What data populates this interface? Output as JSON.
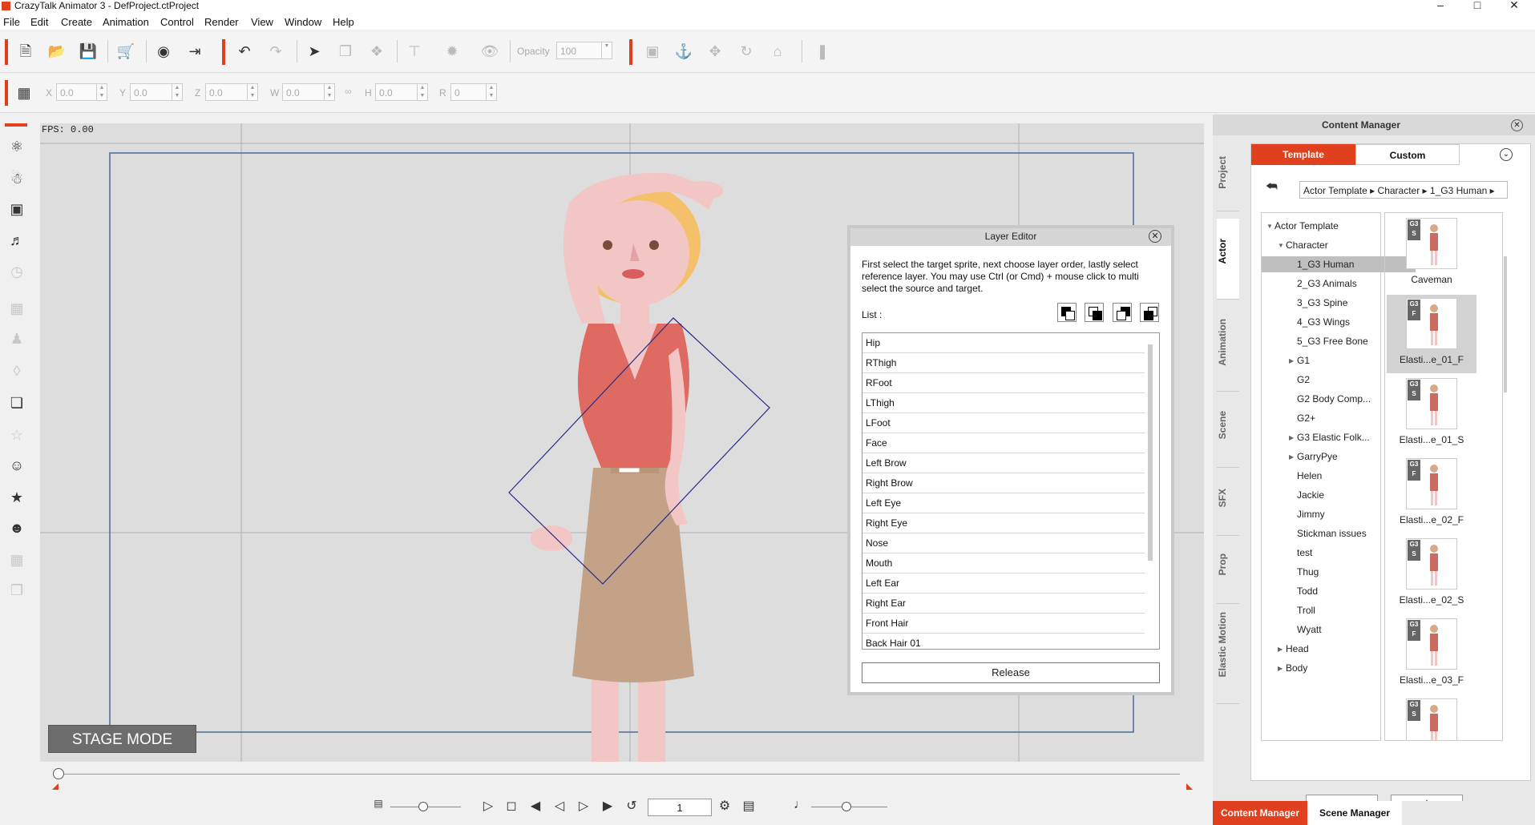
{
  "window": {
    "title": "CrazyTalk Animator 3  - DefProject.ctProject"
  },
  "menu": [
    "File",
    "Edit",
    "Create",
    "Animation",
    "Control",
    "Render",
    "View",
    "Window",
    "Help"
  ],
  "toolbar": {
    "opacity_label": "Opacity",
    "opacity_value": "100"
  },
  "transform": {
    "x_label": "X",
    "x_value": "0.0",
    "y_label": "Y",
    "y_value": "0.0",
    "z_label": "Z",
    "z_value": "0.0",
    "w_label": "W",
    "w_value": "0.0",
    "h_label": "H",
    "h_value": "0.0",
    "r_label": "R",
    "r_value": "0"
  },
  "stage": {
    "fps": "FPS: 0.00",
    "mode_label": "STAGE MODE"
  },
  "timeline": {
    "frame": "1"
  },
  "layer_editor": {
    "title": "Layer Editor",
    "description": "First select the target sprite, next choose layer order, lastly select reference layer. You may use Ctrl (or Cmd) + mouse click to multi select the source and target.",
    "list_label": "List :",
    "items": [
      "Hip",
      "RThigh",
      "RFoot",
      "LThigh",
      "LFoot",
      "Face",
      "Left Brow",
      "Right Brow",
      "Left Eye",
      "Right Eye",
      "Nose",
      "Mouth",
      "Left Ear",
      "Right Ear",
      "Front Hair",
      "Back Hair 01"
    ],
    "release_label": "Release"
  },
  "content_manager": {
    "title": "Content Manager",
    "side_tabs": [
      "Project",
      "Actor",
      "Animation",
      "Scene",
      "SFX",
      "Prop",
      "Elastic Motion"
    ],
    "active_side_tab": "Actor",
    "tabs": {
      "template": "Template",
      "custom": "Custom"
    },
    "breadcrumb": [
      "Actor Template",
      "Character",
      "1_G3 Human"
    ],
    "tree": [
      {
        "label": "Actor Template",
        "depth": 0,
        "arrow": "down"
      },
      {
        "label": "Character",
        "depth": 1,
        "arrow": "down"
      },
      {
        "label": "1_G3 Human",
        "depth": 2,
        "arrow": "",
        "selected": true
      },
      {
        "label": "2_G3 Animals",
        "depth": 2,
        "arrow": ""
      },
      {
        "label": "3_G3 Spine",
        "depth": 2,
        "arrow": ""
      },
      {
        "label": "4_G3 Wings",
        "depth": 2,
        "arrow": ""
      },
      {
        "label": "5_G3 Free Bone",
        "depth": 2,
        "arrow": ""
      },
      {
        "label": "G1",
        "depth": 2,
        "arrow": "right"
      },
      {
        "label": "G2",
        "depth": 2,
        "arrow": ""
      },
      {
        "label": "G2 Body Comp...",
        "depth": 2,
        "arrow": ""
      },
      {
        "label": "G2+",
        "depth": 2,
        "arrow": ""
      },
      {
        "label": "G3 Elastic Folk...",
        "depth": 2,
        "arrow": "right"
      },
      {
        "label": "GarryPye",
        "depth": 2,
        "arrow": "right"
      },
      {
        "label": "Helen",
        "depth": 2,
        "arrow": ""
      },
      {
        "label": "Jackie",
        "depth": 2,
        "arrow": ""
      },
      {
        "label": "Jimmy",
        "depth": 2,
        "arrow": ""
      },
      {
        "label": "Stickman issues",
        "depth": 2,
        "arrow": ""
      },
      {
        "label": "test",
        "depth": 2,
        "arrow": ""
      },
      {
        "label": "Thug",
        "depth": 2,
        "arrow": ""
      },
      {
        "label": "Todd",
        "depth": 2,
        "arrow": ""
      },
      {
        "label": "Troll",
        "depth": 2,
        "arrow": ""
      },
      {
        "label": "Wyatt",
        "depth": 2,
        "arrow": ""
      },
      {
        "label": "Head",
        "depth": 1,
        "arrow": "right"
      },
      {
        "label": "Body",
        "depth": 1,
        "arrow": "right"
      }
    ],
    "thumbnails": [
      {
        "label": "Caveman",
        "badge": "G3 S"
      },
      {
        "label": "Elasti...e_01_F",
        "badge": "G3 F",
        "selected": true
      },
      {
        "label": "Elasti...e_01_S",
        "badge": "G3 S"
      },
      {
        "label": "Elasti...e_02_F",
        "badge": "G3 F"
      },
      {
        "label": "Elasti...e_02_S",
        "badge": "G3 S"
      },
      {
        "label": "Elasti...e_03_F",
        "badge": "G3 F"
      },
      {
        "label": "",
        "badge": "G3 S"
      }
    ]
  },
  "bottom_tabs": {
    "content_manager": "Content Manager",
    "scene_manager": "Scene Manager"
  },
  "colors": {
    "accent": "#e0401d",
    "stage_bg": "#dddddd"
  }
}
